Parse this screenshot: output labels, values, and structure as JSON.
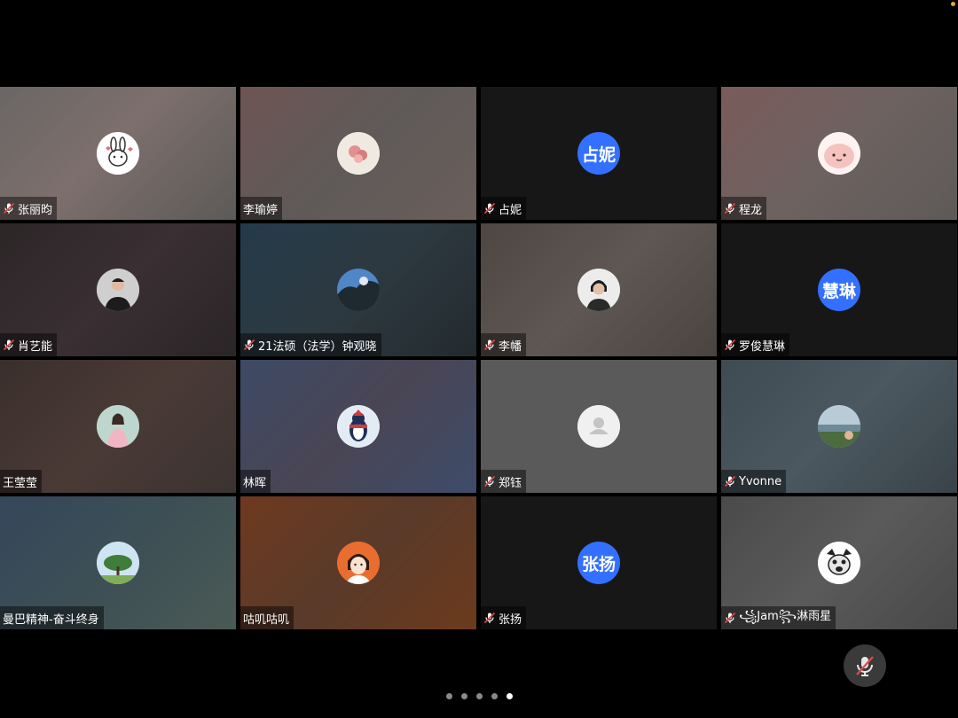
{
  "participants": [
    {
      "name": "张丽昀",
      "muted": true,
      "avatar": "bunny-sticker-icon"
    },
    {
      "name": "李瑜婷",
      "muted": false,
      "avatar": "flower-photo-icon"
    },
    {
      "name": "占妮",
      "muted": true,
      "avatar_text": "占妮"
    },
    {
      "name": "程龙",
      "muted": true,
      "avatar": "pink-cartoon-icon"
    },
    {
      "name": "肖艺能",
      "muted": true,
      "avatar": "person-photo-icon"
    },
    {
      "name": "21法硕（法学）钟观晓",
      "muted": true,
      "avatar": "tree-sky-photo-icon"
    },
    {
      "name": "李幡",
      "muted": true,
      "avatar": "person-photo-icon"
    },
    {
      "name": "罗俊慧琳",
      "muted": true,
      "avatar_text": "慧琳"
    },
    {
      "name": "王莹莹",
      "muted": false,
      "avatar": "girl-photo-icon"
    },
    {
      "name": "林晖",
      "muted": false,
      "avatar": "penguin-icon"
    },
    {
      "name": "郑钰",
      "muted": true,
      "avatar": "default-user-icon"
    },
    {
      "name": "Yvonne",
      "muted": true,
      "avatar": "sea-photo-icon"
    },
    {
      "name": "曼巴精神-奋斗终身",
      "muted": false,
      "avatar": "tree-photo-icon"
    },
    {
      "name": "咕叽咕叽",
      "muted": false,
      "avatar": "cartoon-girl-icon"
    },
    {
      "name": "张扬",
      "muted": true,
      "avatar_text": "张扬"
    },
    {
      "name": "꧁Jam꧂淋雨星",
      "muted": true,
      "avatar": "dog-icon"
    }
  ],
  "pager": {
    "pages": 5,
    "current": 5
  },
  "colors": {
    "avatar_blue": "#3370ff",
    "status_orange": "#e8a33d"
  }
}
